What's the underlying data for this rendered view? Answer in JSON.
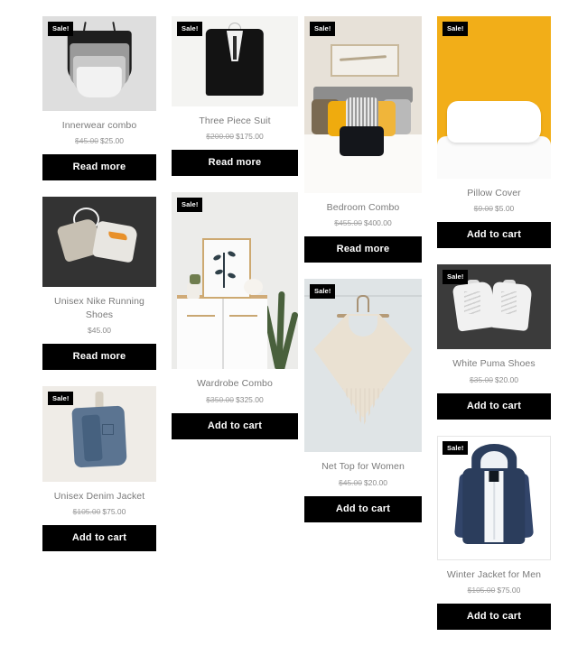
{
  "page": {
    "type": "product-grid",
    "badge_label": "Sale!",
    "currency": "$",
    "accent_color": "#000000",
    "title_color": "#7a7a7a",
    "background": "#ffffff"
  },
  "columns": [
    {
      "name": "column-1",
      "products": [
        {
          "name": "Innerwear combo",
          "on_sale": true,
          "badge": "Sale!",
          "price_old": "$45.00",
          "price_new": "$25.00",
          "button": "Read more",
          "image": "innerwear-combo-photo"
        },
        {
          "name": "Unisex Nike Running Shoes",
          "on_sale": false,
          "badge": "",
          "price_old": "",
          "price_new": "$45.00",
          "button": "Read more",
          "image": "nike-running-shoes-photo"
        },
        {
          "name": "Unisex Denim Jacket",
          "on_sale": true,
          "badge": "Sale!",
          "price_old": "$105.00",
          "price_new": "$75.00",
          "button": "Add to cart",
          "image": "denim-jacket-photo"
        }
      ]
    },
    {
      "name": "column-2",
      "products": [
        {
          "name": "Three Piece Suit",
          "on_sale": true,
          "badge": "Sale!",
          "price_old": "$200.00",
          "price_new": "$175.00",
          "button": "Read more",
          "image": "three-piece-suit-photo"
        },
        {
          "name": "Wardrobe Combo",
          "on_sale": true,
          "badge": "Sale!",
          "price_old": "$350.00",
          "price_new": "$325.00",
          "button": "Add to cart",
          "image": "wardrobe-combo-photo"
        }
      ]
    },
    {
      "name": "column-3",
      "products": [
        {
          "name": "Bedroom Combo",
          "on_sale": true,
          "badge": "Sale!",
          "price_old": "$455.00",
          "price_new": "$400.00",
          "button": "Read more",
          "image": "bedroom-combo-photo"
        },
        {
          "name": "Net Top for Women",
          "on_sale": true,
          "badge": "Sale!",
          "price_old": "$45.00",
          "price_new": "$20.00",
          "button": "Add to cart",
          "image": "net-top-photo"
        }
      ]
    },
    {
      "name": "column-4",
      "products": [
        {
          "name": "Pillow Cover",
          "on_sale": true,
          "badge": "Sale!",
          "price_old": "$9.00",
          "price_new": "$5.00",
          "button": "Add to cart",
          "image": "pillow-cover-photo"
        },
        {
          "name": "White Puma Shoes",
          "on_sale": true,
          "badge": "Sale!",
          "price_old": "$35.00",
          "price_new": "$20.00",
          "button": "Add to cart",
          "image": "white-puma-shoes-photo"
        },
        {
          "name": "Winter Jacket for Men",
          "on_sale": true,
          "badge": "Sale!",
          "price_old": "$105.00",
          "price_new": "$75.00",
          "button": "Add to cart",
          "image": "winter-jacket-photo"
        }
      ]
    }
  ]
}
